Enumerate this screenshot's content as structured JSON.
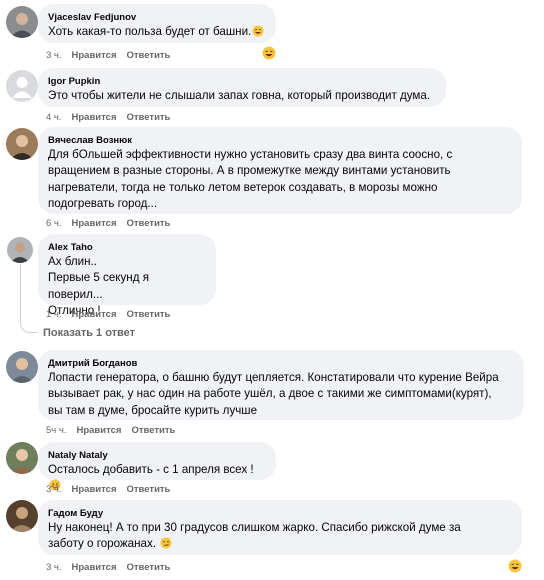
{
  "comments": [
    {
      "author": "Vjaceslav Fedjunov",
      "text": "Хоть какая-то польза будет от башни.",
      "time": "3 ч.",
      "like": "Нравится",
      "reply": "Ответить",
      "avatar_icon": "person-photo",
      "inline_emoji": "laughing-emoji",
      "reaction_emoji": "laughing-emoji"
    },
    {
      "author": "Igor Pupkin",
      "text": "Это чтобы жители не слышали запах говна, который производит дума.",
      "time": "4 ч.",
      "like": "Нравится",
      "reply": "Ответить",
      "avatar_icon": "default-user-silhouette"
    },
    {
      "author": "Вячеслав Вознюк",
      "text": "Для бОльшей эффективности нужно установить сразу два винта соосно, с\nвращением в разные стороны. А в промежутке между винтами установить\nнагреватели, тогда не только летом ветерок создавать, в морозы можно\nподогревать город...",
      "time": "6 ч.",
      "like": "Нравится",
      "reply": "Ответить",
      "avatar_icon": "person-photo"
    },
    {
      "author": "Alex Taho",
      "text": "Ах блин..\nПервые 5 секунд я поверил...\nОтлично !",
      "time": "1 ч.",
      "like": "Нравится",
      "reply": "Ответить",
      "avatar_icon": "person-photo"
    },
    {
      "author": "Дмитрий Богданов",
      "text": "Лопасти генератора, о башню будут цепляется. Констатировали что курение Вейра\nвызывает рак, у нас один на работе ушёл, а двое с такими же симптомами(курят),\nвы там в думе, бросайте курить лучше",
      "time": "5ч ч.",
      "like": "Нравится",
      "reply": "Ответить",
      "avatar_icon": "person-photo"
    },
    {
      "author": "Nataly Nataly",
      "text": "Осталось добавить - с 1 апреля всех !",
      "time": "3 ч.",
      "like": "Нравится",
      "reply": "Ответить",
      "avatar_icon": "person-photo",
      "inline_emoji": "grinning-sweat-emoji"
    },
    {
      "author": "Гадом Буду",
      "text": "Ну наконец! А то при 30 градусов слишком жарко. Спасибо рижской думе за\nзаботу о горожанах.",
      "time": "3 ч.",
      "like": "Нравится",
      "reply": "Ответить",
      "avatar_icon": "person-photo",
      "inline_emoji": "smirk-emoji",
      "reaction_emoji": "laughing-emoji"
    }
  ],
  "show_replies": "Показать 1 ответ",
  "colors": {
    "bubble": "#f0f2f5",
    "meta_text": "#65676b",
    "text": "#050505",
    "thread_line": "#ccd0d5"
  }
}
